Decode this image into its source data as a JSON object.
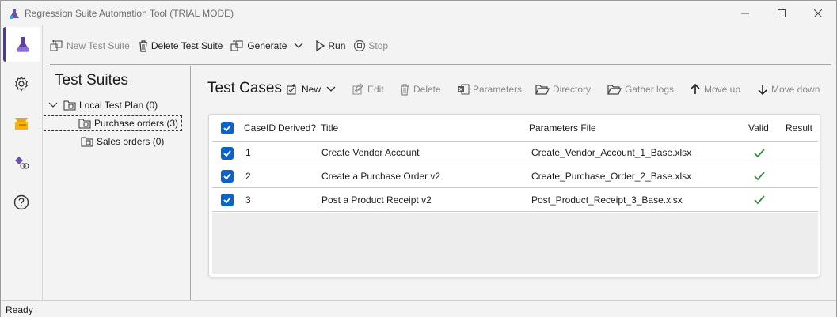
{
  "window": {
    "title": "Regression Suite Automation Tool (TRIAL MODE)"
  },
  "toolbar": {
    "new_suite": "New Test Suite",
    "delete_suite": "Delete Test Suite",
    "generate": "Generate",
    "run": "Run",
    "stop": "Stop"
  },
  "suites": {
    "heading": "Test Suites",
    "root": "Local Test Plan (0)",
    "items": [
      "Purchase orders (3)",
      "Sales orders (0)"
    ]
  },
  "cases": {
    "heading": "Test Cases",
    "tools": {
      "new": "New",
      "edit": "Edit",
      "delete": "Delete",
      "parameters": "Parameters",
      "directory": "Directory",
      "gather_logs": "Gather logs",
      "move_up": "Move up",
      "move_down": "Move down"
    },
    "columns": {
      "caseid": "CaseID",
      "derived": "Derived?",
      "title": "Title",
      "params": "Parameters File",
      "valid": "Valid",
      "result": "Result"
    },
    "rows": [
      {
        "id": "1",
        "title": "Create Vendor Account",
        "file": "Create_Vendor_Account_1_Base.xlsx"
      },
      {
        "id": "2",
        "title": "Create a Purchase Order v2",
        "file": "Create_Purchase_Order_2_Base.xlsx"
      },
      {
        "id": "3",
        "title": "Post a Product Receipt v2",
        "file": "Post_Product_Receipt_3_Base.xlsx"
      }
    ]
  },
  "status": {
    "text": "Ready"
  },
  "colors": {
    "accent": "#0a63c9",
    "valid": "#2e8b3e",
    "brand": "#4f3a8f"
  }
}
